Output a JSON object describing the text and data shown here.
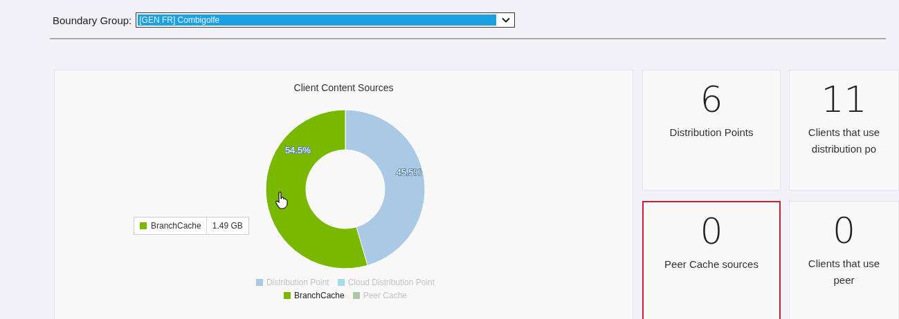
{
  "boundary_group": {
    "label": "Boundary Group:",
    "value": "[GEN FR] Combigolfe"
  },
  "chart": {
    "chart_data": {
      "type": "donut",
      "title": "Client Content Sources",
      "categories": [
        "Distribution Point",
        "Cloud Distribution Point",
        "BranchCache",
        "Peer Cache"
      ],
      "values": [
        45.5,
        0,
        54.5,
        0
      ],
      "value_labels": [
        "45.5%",
        null,
        "54.5%",
        null
      ],
      "legend": "bottom"
    },
    "legend": [
      {
        "color": "#a9c9e4",
        "selected": false
      },
      {
        "color": "#a6dcea",
        "selected": false
      },
      {
        "color": "#7ab800",
        "selected": true
      },
      {
        "color": "#a7c9a3",
        "selected": false
      }
    ],
    "tooltip": {
      "color": "#7ab800",
      "label": "BranchCache",
      "value": "1.49 GB"
    }
  },
  "tiles": [
    {
      "value": "6",
      "label": "Distribution Points",
      "selected": false
    },
    {
      "value": "11",
      "label": "Clients that use distribution po",
      "selected": false
    },
    {
      "value": "0",
      "label": "Peer Cache sources",
      "selected": true
    },
    {
      "value": "0",
      "label": "Clients that use peer",
      "selected": false
    }
  ]
}
